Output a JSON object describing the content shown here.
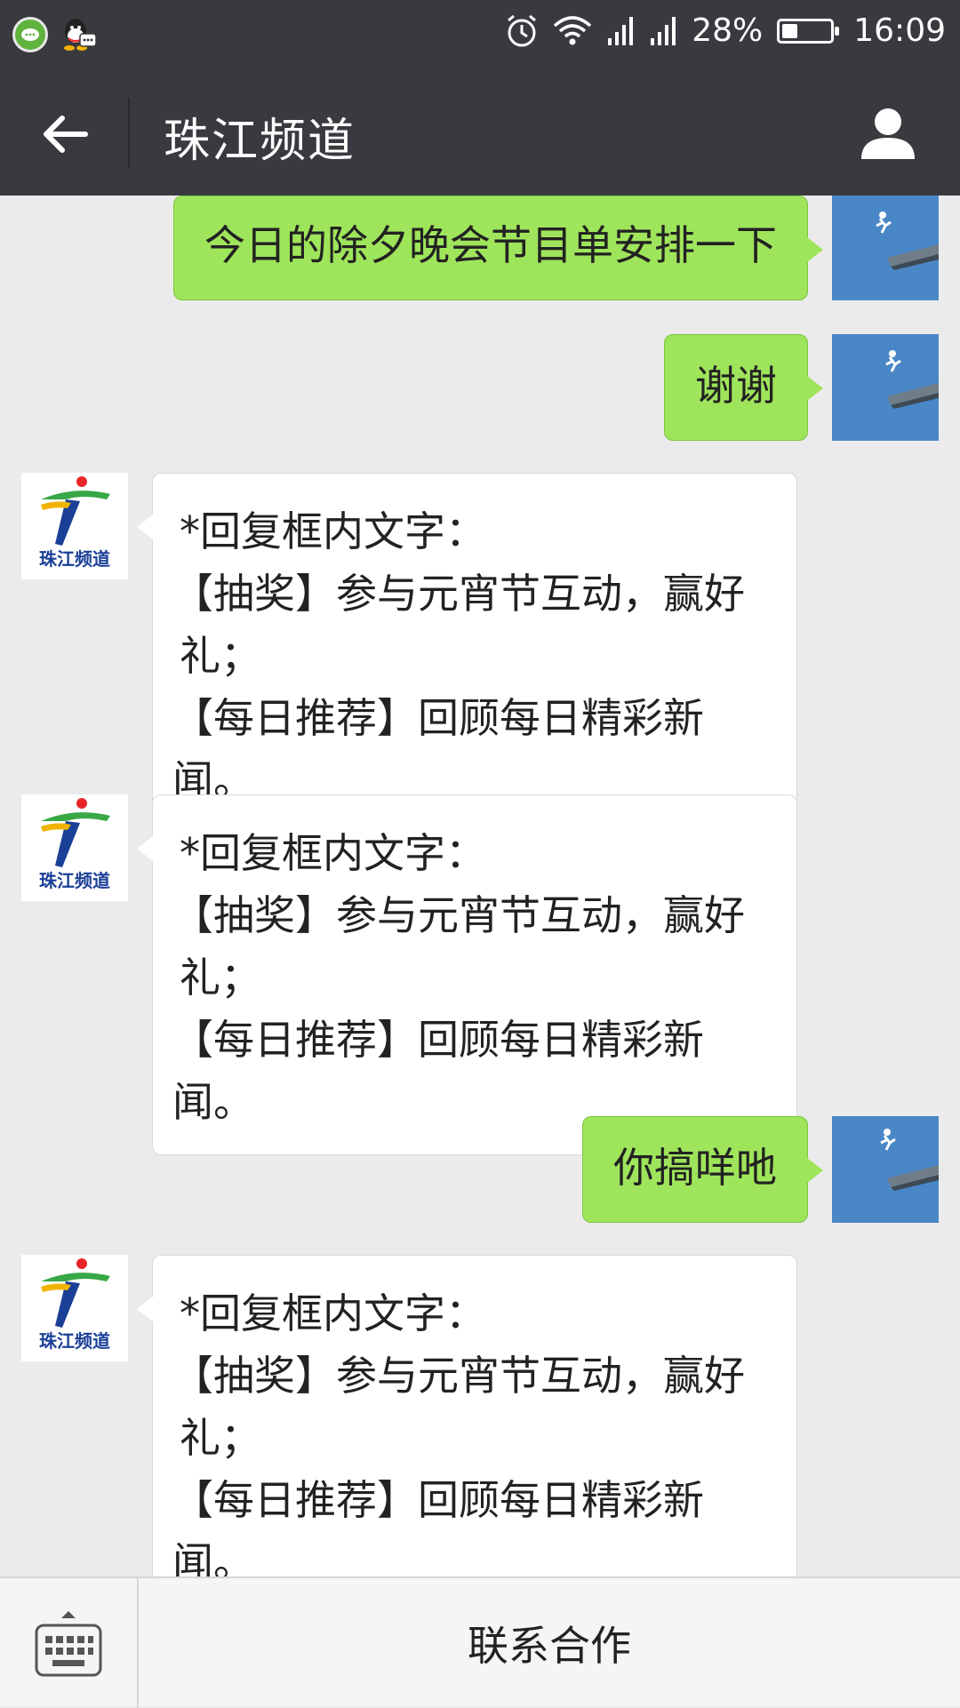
{
  "status_bar": {
    "battery_text": "28%",
    "battery_level": 0.28,
    "time": "16:09",
    "icons": [
      "wechat-icon",
      "qq-icon",
      "alarm-icon",
      "wifi-icon",
      "signal-icon",
      "signal-icon",
      "battery-icon"
    ]
  },
  "header": {
    "title": "珠江频道",
    "back_icon": "back-arrow-icon",
    "profile_icon": "person-icon"
  },
  "messages": [
    {
      "direction": "out",
      "text": "今日的除夕晚会节目单安排一下"
    },
    {
      "direction": "out",
      "text": "谢谢"
    },
    {
      "direction": "in",
      "lines": [
        "*回复框内文字：",
        "【抽奖】参与元宵节互动，赢好",
        "礼；",
        "【每日推荐】回顾每日精彩新闻。"
      ]
    },
    {
      "direction": "in",
      "lines": [
        "*回复框内文字：",
        "【抽奖】参与元宵节互动，赢好",
        "礼；",
        "【每日推荐】回顾每日精彩新闻。"
      ]
    },
    {
      "direction": "out",
      "text": "你搞咩吔"
    },
    {
      "direction": "in",
      "lines": [
        "*回复框内文字：",
        "【抽奖】参与元宵节互动，赢好",
        "礼；",
        "【每日推荐】回顾每日精彩新闻。"
      ]
    }
  ],
  "channel_logo_text": "珠江频道",
  "bottom_bar": {
    "keyboard_icon": "keyboard-icon",
    "menu_label": "联系合作"
  }
}
